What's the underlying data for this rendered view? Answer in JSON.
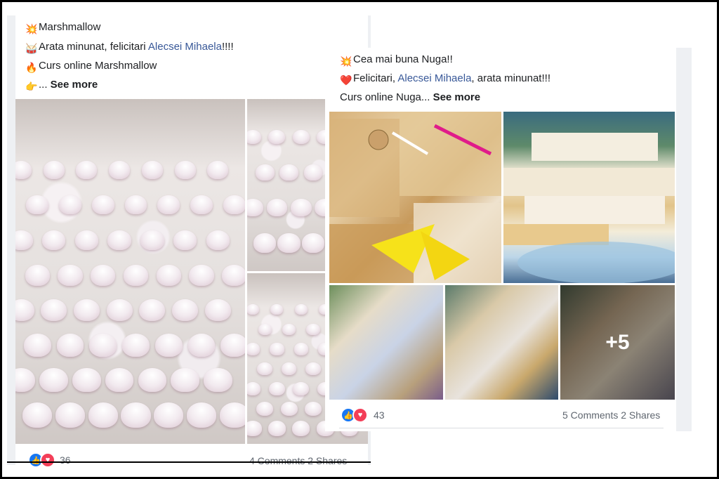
{
  "post1": {
    "lines": [
      {
        "emoji": "💥",
        "text": "Marshmallow"
      },
      {
        "emoji": "🥁",
        "text_before": "Arata minunat, felicitari ",
        "link": "Alecsei Mihaela",
        "text_after": "!!!!"
      },
      {
        "emoji": "🔥",
        "text": "Curs online Marshmallow"
      },
      {
        "emoji": "👉",
        "text": "... ",
        "see_more": "See more"
      }
    ],
    "reaction_count": "36",
    "comments": "4 Comments",
    "shares": "2 Shares"
  },
  "post2": {
    "lines": [
      {
        "emoji": "💥",
        "text": "Cea mai buna Nuga!!"
      },
      {
        "emoji": "❤️",
        "text_before": "Felicitari, ",
        "link": "Alecsei Mihaela",
        "text_after": ", arata minunat!!!"
      },
      {
        "text": "Curs online Nuga... ",
        "see_more": "See more"
      }
    ],
    "more_photos": "+5",
    "reaction_count": "43",
    "comments": "5 Comments",
    "shares": "2 Shares"
  },
  "icons": {
    "like": "thumbs-up-icon",
    "love": "heart-icon"
  },
  "colors": {
    "link": "#385898",
    "like": "#1877f2",
    "love": "#f33e58"
  }
}
